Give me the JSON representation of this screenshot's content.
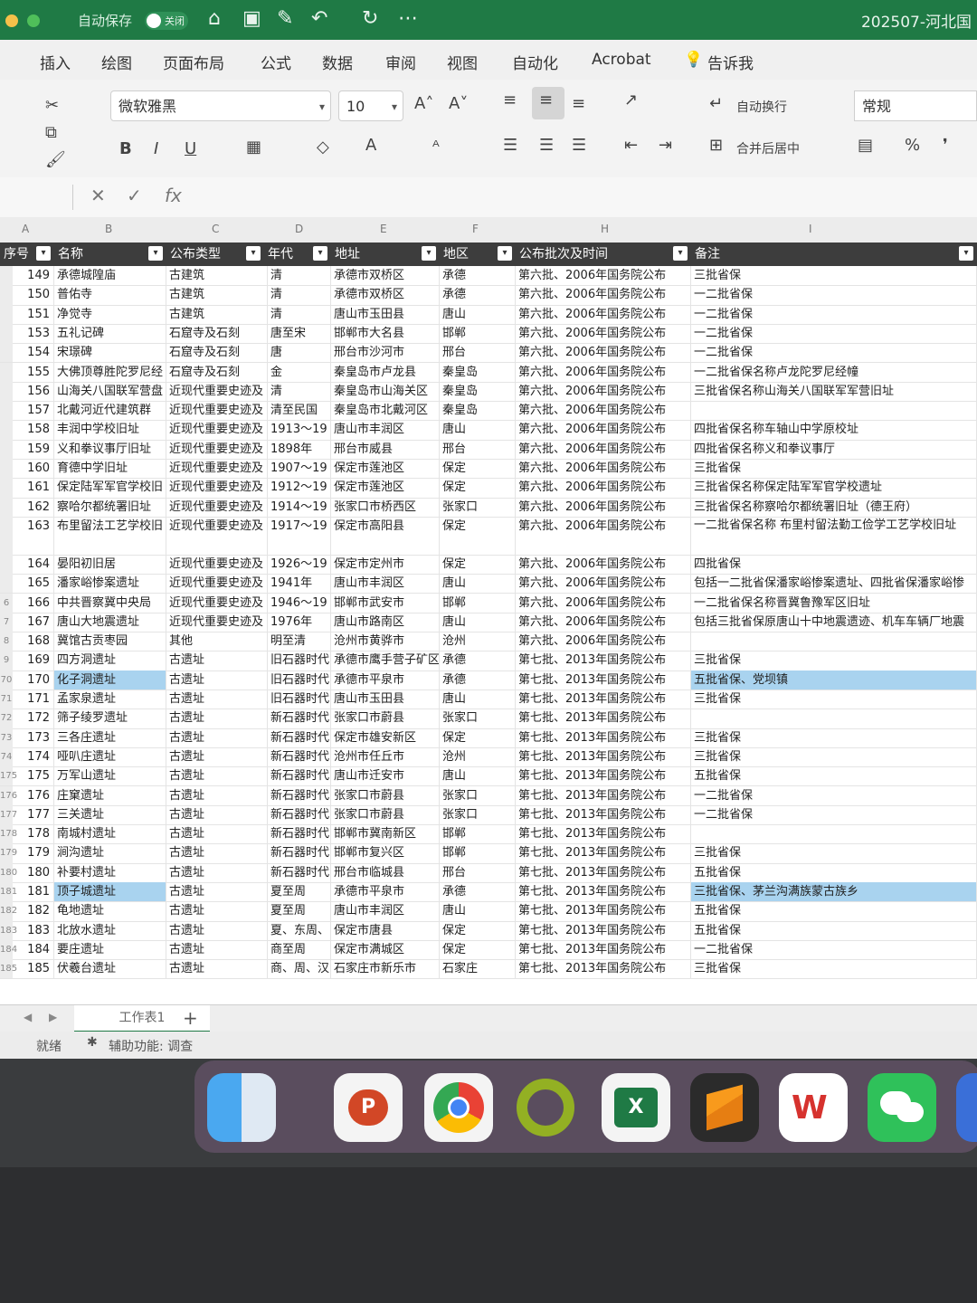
{
  "titlebar": {
    "autosave_label": "自动保存",
    "toggle_label": "关闭",
    "doc_name": "202507-河北国"
  },
  "menu": [
    "插入",
    "绘图",
    "页面布局",
    "公式",
    "数据",
    "审阅",
    "视图",
    "自动化",
    "Acrobat",
    "告诉我"
  ],
  "ribbon": {
    "font_name": "微软雅黑",
    "font_size": "10",
    "wrap_text": "自动换行",
    "merge_center": "合并后居中",
    "number_format": "常规",
    "bold": "B",
    "italic": "I",
    "underline": "U"
  },
  "formula_bar": {
    "fx": "fx"
  },
  "columns": [
    "A",
    "B",
    "C",
    "D",
    "E",
    "F",
    "H",
    "I"
  ],
  "headers": [
    "序号",
    "名称",
    "公布类型",
    "年代",
    "地址",
    "地区",
    "公布批次及时间",
    "备注"
  ],
  "rows": [
    {
      "r": "",
      "c": [
        "149",
        "承德城隍庙",
        "古建筑",
        "清",
        "承德市双桥区",
        "承德",
        "第六批、2006年国务院公布",
        "三批省保"
      ]
    },
    {
      "r": "",
      "c": [
        "150",
        "普佑寺",
        "古建筑",
        "清",
        "承德市双桥区",
        "承德",
        "第六批、2006年国务院公布",
        "一二批省保"
      ]
    },
    {
      "r": "",
      "c": [
        "151",
        "净觉寺",
        "古建筑",
        "清",
        "唐山市玉田县",
        "唐山",
        "第六批、2006年国务院公布",
        "一二批省保"
      ]
    },
    {
      "r": "",
      "c": [
        "153",
        "五礼记碑",
        "石窟寺及石刻",
        "唐至宋",
        "邯郸市大名县",
        "邯郸",
        "第六批、2006年国务院公布",
        "一二批省保"
      ]
    },
    {
      "r": "",
      "c": [
        "154",
        "宋璟碑",
        "石窟寺及石刻",
        "唐",
        "邢台市沙河市",
        "邢台",
        "第六批、2006年国务院公布",
        "一二批省保"
      ]
    },
    {
      "r": "",
      "c": [
        "155",
        "大佛顶尊胜陀罗尼经",
        "石窟寺及石刻",
        "金",
        "秦皇岛市卢龙县",
        "秦皇岛",
        "第六批、2006年国务院公布",
        "一二批省保名称卢龙陀罗尼经幢"
      ]
    },
    {
      "r": "",
      "c": [
        "156",
        "山海关八国联军营盘",
        "近现代重要史迹及",
        "清",
        "秦皇岛市山海关区",
        "秦皇岛",
        "第六批、2006年国务院公布",
        "三批省保名称山海关八国联军军营旧址"
      ]
    },
    {
      "r": "",
      "c": [
        "157",
        "北戴河近代建筑群",
        "近现代重要史迹及",
        "清至民国",
        "秦皇岛市北戴河区",
        "秦皇岛",
        "第六批、2006年国务院公布",
        ""
      ]
    },
    {
      "r": "",
      "c": [
        "158",
        "丰润中学校旧址",
        "近现代重要史迹及",
        "1913～19",
        "唐山市丰润区",
        "唐山",
        "第六批、2006年国务院公布",
        "四批省保名称车轴山中学原校址"
      ]
    },
    {
      "r": "",
      "c": [
        "159",
        "义和拳议事厅旧址",
        "近现代重要史迹及",
        "1898年",
        "邢台市威县",
        "邢台",
        "第六批、2006年国务院公布",
        "四批省保名称义和拳议事厅"
      ]
    },
    {
      "r": "",
      "c": [
        "160",
        "育德中学旧址",
        "近现代重要史迹及",
        "1907～19",
        "保定市莲池区",
        "保定",
        "第六批、2006年国务院公布",
        "三批省保"
      ]
    },
    {
      "r": "",
      "c": [
        "161",
        "保定陆军军官学校旧",
        "近现代重要史迹及",
        "1912～19",
        "保定市莲池区",
        "保定",
        "第六批、2006年国务院公布",
        "三批省保名称保定陆军军官学校遗址"
      ]
    },
    {
      "r": "",
      "c": [
        "162",
        "察哈尔都统署旧址",
        "近现代重要史迹及",
        "1914～19",
        "张家口市桥西区",
        "张家口",
        "第六批、2006年国务院公布",
        "三批省保名称察哈尔都统署旧址（德王府）"
      ]
    },
    {
      "r": "",
      "tall": true,
      "c": [
        "163",
        "布里留法工艺学校旧",
        "近现代重要史迹及",
        "1917～19",
        "保定市高阳县",
        "保定",
        "第六批、2006年国务院公布",
        "一二批省保名称 布里村留法勤工俭学工艺学校旧址"
      ]
    },
    {
      "r": "",
      "c": [
        "164",
        "晏阳初旧居",
        "近现代重要史迹及",
        "1926～19",
        "保定市定州市",
        "保定",
        "第六批、2006年国务院公布",
        "四批省保"
      ]
    },
    {
      "r": "",
      "c": [
        "165",
        "潘家峪惨案遗址",
        "近现代重要史迹及",
        "1941年",
        "唐山市丰润区",
        "唐山",
        "第六批、2006年国务院公布",
        "包括一二批省保潘家峪惨案遗址、四批省保潘家峪惨"
      ]
    },
    {
      "r": "6",
      "c": [
        "166",
        "中共晋察冀中央局",
        "近现代重要史迹及",
        "1946～19",
        "邯郸市武安市",
        "邯郸",
        "第六批、2006年国务院公布",
        "一二批省保名称晋冀鲁豫军区旧址"
      ]
    },
    {
      "r": "7",
      "c": [
        "167",
        "唐山大地震遗址",
        "近现代重要史迹及",
        "1976年",
        "唐山市路南区",
        "唐山",
        "第六批、2006年国务院公布",
        "包括三批省保原唐山十中地震遗迹、机车车辆厂地震"
      ]
    },
    {
      "r": "8",
      "c": [
        "168",
        "冀馆古贡枣园",
        "其他",
        "明至清",
        "沧州市黄骅市",
        "沧州",
        "第六批、2006年国务院公布",
        ""
      ]
    },
    {
      "r": "9",
      "c": [
        "169",
        "四方洞遗址",
        "古遗址",
        "旧石器时代",
        "承德市鹰手营子矿区",
        "承德",
        "第七批、2013年国务院公布",
        "三批省保"
      ]
    },
    {
      "r": "70",
      "hl": true,
      "c": [
        "170",
        "化子洞遗址",
        "古遗址",
        "旧石器时代",
        "承德市平泉市",
        "承德",
        "第七批、2013年国务院公布",
        "五批省保、党坝镇"
      ]
    },
    {
      "r": "71",
      "c": [
        "171",
        "孟家泉遗址",
        "古遗址",
        "旧石器时代",
        "唐山市玉田县",
        "唐山",
        "第七批、2013年国务院公布",
        "三批省保"
      ]
    },
    {
      "r": "72",
      "c": [
        "172",
        "筛子绫罗遗址",
        "古遗址",
        "新石器时代",
        "张家口市蔚县",
        "张家口",
        "第七批、2013年国务院公布",
        ""
      ]
    },
    {
      "r": "73",
      "c": [
        "173",
        "三各庄遗址",
        "古遗址",
        "新石器时代",
        "保定市雄安新区",
        "保定",
        "第七批、2013年国务院公布",
        "三批省保"
      ]
    },
    {
      "r": "74",
      "c": [
        "174",
        "哑叭庄遗址",
        "古遗址",
        "新石器时代",
        "沧州市任丘市",
        "沧州",
        "第七批、2013年国务院公布",
        "三批省保"
      ]
    },
    {
      "r": "175",
      "c": [
        "175",
        "万军山遗址",
        "古遗址",
        "新石器时代",
        "唐山市迁安市",
        "唐山",
        "第七批、2013年国务院公布",
        "五批省保"
      ]
    },
    {
      "r": "176",
      "c": [
        "176",
        "庄窠遗址",
        "古遗址",
        "新石器时代",
        "张家口市蔚县",
        "张家口",
        "第七批、2013年国务院公布",
        "一二批省保"
      ]
    },
    {
      "r": "177",
      "c": [
        "177",
        "三关遗址",
        "古遗址",
        "新石器时代",
        "张家口市蔚县",
        "张家口",
        "第七批、2013年国务院公布",
        "一二批省保"
      ]
    },
    {
      "r": "178",
      "c": [
        "178",
        "南城村遗址",
        "古遗址",
        "新石器时代",
        "邯郸市冀南新区",
        "邯郸",
        "第七批、2013年国务院公布",
        ""
      ]
    },
    {
      "r": "179",
      "c": [
        "179",
        "涧沟遗址",
        "古遗址",
        "新石器时代",
        "邯郸市复兴区",
        "邯郸",
        "第七批、2013年国务院公布",
        "三批省保"
      ]
    },
    {
      "r": "180",
      "c": [
        "180",
        "补要村遗址",
        "古遗址",
        "新石器时代",
        "邢台市临城县",
        "邢台",
        "第七批、2013年国务院公布",
        "五批省保"
      ]
    },
    {
      "r": "181",
      "hl": true,
      "c": [
        "181",
        "顶子城遗址",
        "古遗址",
        "夏至周",
        "承德市平泉市",
        "承德",
        "第七批、2013年国务院公布",
        "三批省保、茅兰沟满族蒙古族乡"
      ]
    },
    {
      "r": "182",
      "c": [
        "182",
        "龟地遗址",
        "古遗址",
        "夏至周",
        "唐山市丰润区",
        "唐山",
        "第七批、2013年国务院公布",
        "五批省保"
      ]
    },
    {
      "r": "183",
      "c": [
        "183",
        "北放水遗址",
        "古遗址",
        "夏、东周、",
        "保定市唐县",
        "保定",
        "第七批、2013年国务院公布",
        "五批省保"
      ]
    },
    {
      "r": "184",
      "c": [
        "184",
        "要庄遗址",
        "古遗址",
        "商至周",
        "保定市满城区",
        "保定",
        "第七批、2013年国务院公布",
        "一二批省保"
      ]
    },
    {
      "r": "185",
      "c": [
        "185",
        "伏羲台遗址",
        "古遗址",
        "商、周、汉",
        "石家庄市新乐市",
        "石家庄",
        "第七批、2013年国务院公布",
        "三批省保"
      ]
    }
  ],
  "sheet_tab": "工作表1",
  "add_sheet": "+",
  "status": {
    "ready": "就绪",
    "accessibility": "辅助功能: 调查"
  },
  "dock_apps": [
    "finder-icon",
    "powerpoint-icon",
    "chrome-icon",
    "qgis-icon",
    "excel-icon",
    "sublime-icon",
    "wps-icon",
    "wechat-icon"
  ],
  "colors": {
    "excel_green": "#1f7a45",
    "header_dark": "#3d3d3d",
    "highlight": "#a9d3ef"
  }
}
